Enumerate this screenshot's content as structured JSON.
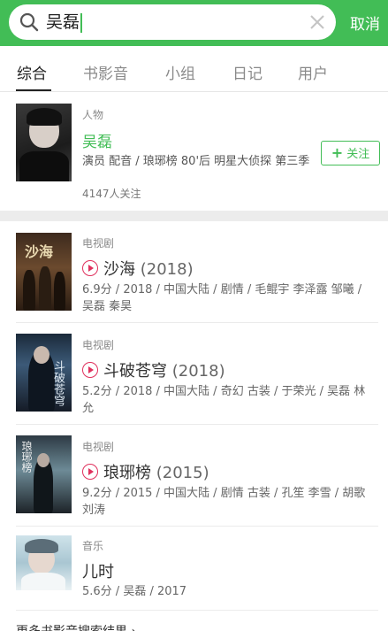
{
  "search": {
    "query": "吴磊",
    "cancel_label": "取消"
  },
  "tabs": [
    {
      "label": "综合",
      "active": true
    },
    {
      "label": "书影音",
      "active": false
    },
    {
      "label": "小组",
      "active": false
    },
    {
      "label": "日记",
      "active": false
    },
    {
      "label": "用户",
      "active": false
    }
  ],
  "person": {
    "category": "人物",
    "name": "吴磊",
    "description": "演员 配音 / 琅琊榜 80'后 明星大侦探 第三季",
    "followers": "4147人关注",
    "follow_label": "关注"
  },
  "results": [
    {
      "category": "电视剧",
      "title": "沙海",
      "year": "(2018)",
      "meta": "6.9分 / 2018 / 中国大陆 / 剧情 / 毛鲲宇 李泽露 邹曦 / 吴磊 秦昊"
    },
    {
      "category": "电视剧",
      "title": "斗破苍穹",
      "year": "(2018)",
      "meta": "5.2分 / 2018 / 中国大陆 / 奇幻 古装 / 于荣光 / 吴磊 林允"
    },
    {
      "category": "电视剧",
      "title": "琅琊榜",
      "year": "(2015)",
      "meta": "9.2分 / 2015 / 中国大陆 / 剧情 古装 / 孔笙 李雪 / 胡歌 刘涛"
    },
    {
      "category": "音乐",
      "title": "儿时",
      "year": "",
      "meta": "5.6分 / 吴磊 / 2017"
    }
  ],
  "more_label": "更多书影音搜索结果 ›",
  "colors": {
    "brand_green": "#42bd56",
    "play_icon": "#e0315d"
  }
}
